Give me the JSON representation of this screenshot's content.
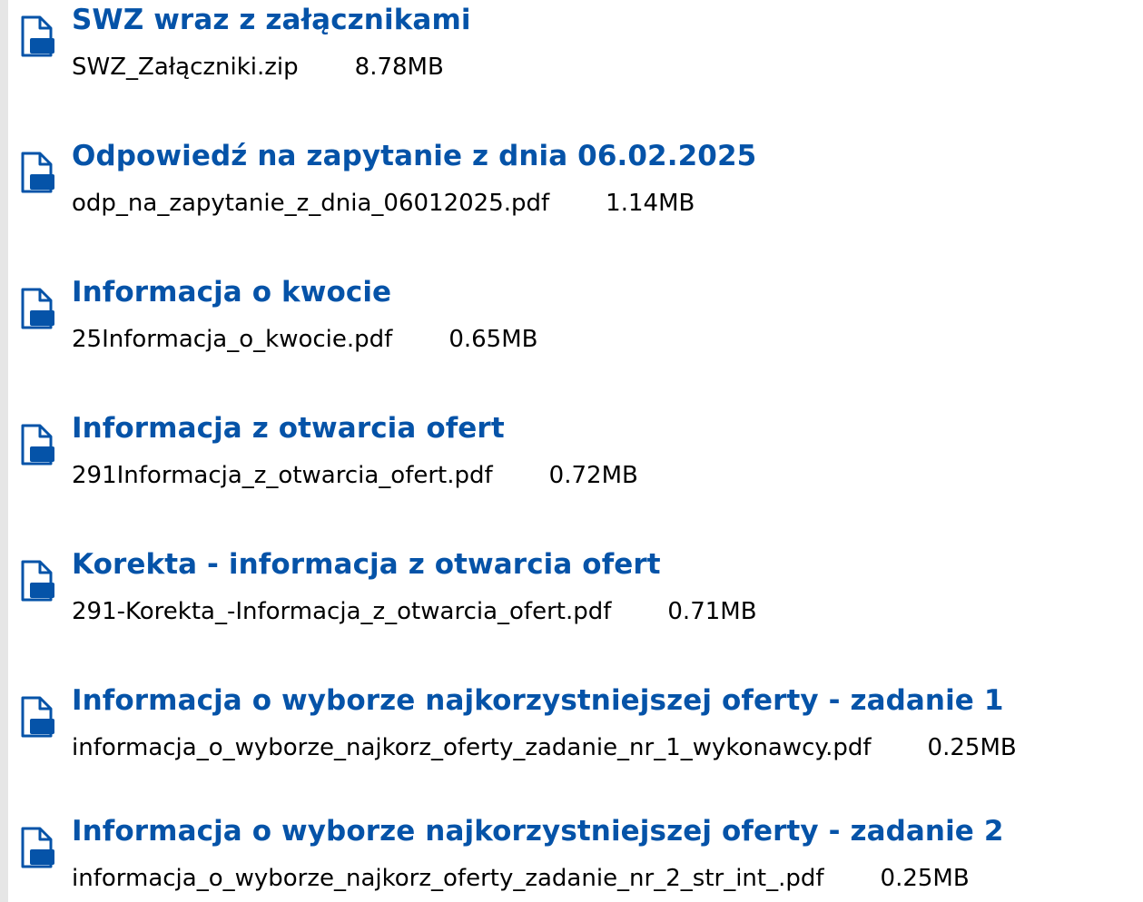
{
  "colors": {
    "title": "#0553a8",
    "text": "#000000",
    "icon": "#0553a8",
    "rule": "#e6e6e6"
  },
  "attachments": [
    {
      "title": "SWZ wraz z załącznikami",
      "file_name": "SWZ_Załączniki.zip",
      "file_size": "8.78MB",
      "icon": "document-icon"
    },
    {
      "title": "Odpowiedź na zapytanie z dnia 06.02.2025",
      "file_name": "odp_na_zapytanie_z_dnia_06012025.pdf",
      "file_size": "1.14MB",
      "icon": "document-icon"
    },
    {
      "title": "Informacja o kwocie",
      "file_name": "25Informacja_o_kwocie.pdf",
      "file_size": "0.65MB",
      "icon": "document-icon"
    },
    {
      "title": "Informacja z otwarcia ofert",
      "file_name": "291Informacja_z_otwarcia_ofert.pdf",
      "file_size": "0.72MB",
      "icon": "document-icon"
    },
    {
      "title": "Korekta - informacja z otwarcia ofert",
      "file_name": "291-Korekta_-Informacja_z_otwarcia_ofert.pdf",
      "file_size": "0.71MB",
      "icon": "document-icon"
    },
    {
      "title": "Informacja o wyborze najkorzystniejszej oferty - zadanie 1",
      "file_name": "informacja_o_wyborze_najkorz_oferty_zadanie_nr_1_wykonawcy.pdf",
      "file_size": "0.25MB",
      "icon": "document-icon"
    },
    {
      "title": "Informacja o wyborze najkorzystniejszej oferty - zadanie 2",
      "file_name": "informacja_o_wyborze_najkorz_oferty_zadanie_nr_2_str_int_.pdf",
      "file_size": "0.25MB",
      "icon": "document-icon"
    }
  ]
}
